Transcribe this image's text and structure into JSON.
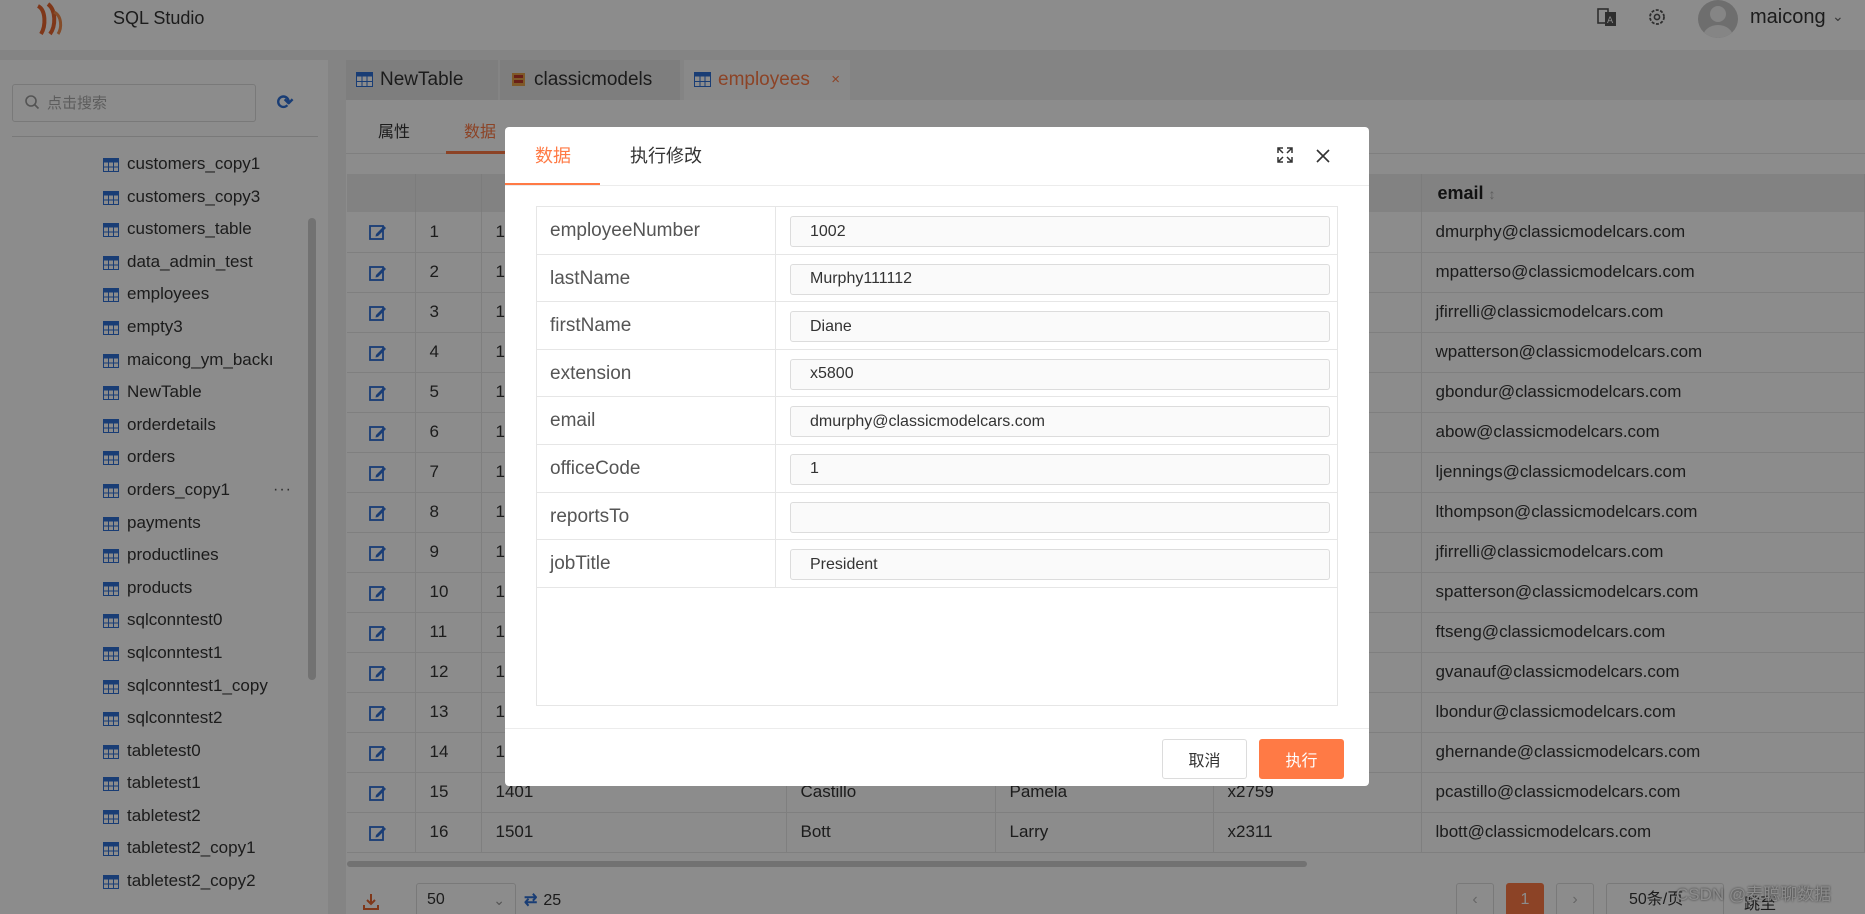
{
  "header": {
    "app_title": "SQL Studio",
    "username": "maicong"
  },
  "sidebar": {
    "search_placeholder": "点击搜索",
    "items": [
      {
        "label": "customers_copy1"
      },
      {
        "label": "customers_copy3"
      },
      {
        "label": "customers_table"
      },
      {
        "label": "data_admin_test"
      },
      {
        "label": "employees"
      },
      {
        "label": "empty3"
      },
      {
        "label": "maicong_ym_backı"
      },
      {
        "label": "NewTable"
      },
      {
        "label": "orderdetails"
      },
      {
        "label": "orders"
      },
      {
        "label": "orders_copy1",
        "more": "···"
      },
      {
        "label": "payments"
      },
      {
        "label": "productlines"
      },
      {
        "label": "products"
      },
      {
        "label": "sqlconntest0"
      },
      {
        "label": "sqlconntest1"
      },
      {
        "label": "sqlconntest1_copy"
      },
      {
        "label": "sqlconntest2"
      },
      {
        "label": "tabletest0"
      },
      {
        "label": "tabletest1"
      },
      {
        "label": "tabletest2"
      },
      {
        "label": "tabletest2_copy1"
      },
      {
        "label": "tabletest2_copy2"
      }
    ]
  },
  "tabs": [
    {
      "label": "NewTable"
    },
    {
      "label": "classicmodels"
    },
    {
      "label": "employees",
      "close": "×"
    }
  ],
  "subtabs": {
    "properties": "属性",
    "data": "数据"
  },
  "grid": {
    "email_header": "email",
    "sort_indicator": "↕",
    "rows": [
      {
        "n": "1",
        "num": "1",
        "last": "",
        "first": "",
        "ext": "",
        "email": "dmurphy@classicmodelcars.com"
      },
      {
        "n": "2",
        "num": "1",
        "last": "",
        "first": "",
        "ext": "",
        "email": "mpatterso@classicmodelcars.com"
      },
      {
        "n": "3",
        "num": "1",
        "last": "",
        "first": "",
        "ext": "",
        "email": "jfirrelli@classicmodelcars.com"
      },
      {
        "n": "4",
        "num": "1",
        "last": "",
        "first": "",
        "ext": "",
        "email": "wpatterson@classicmodelcars.com"
      },
      {
        "n": "5",
        "num": "1",
        "last": "",
        "first": "",
        "ext": "",
        "email": "gbondur@classicmodelcars.com"
      },
      {
        "n": "6",
        "num": "1",
        "last": "",
        "first": "",
        "ext": "",
        "email": "abow@classicmodelcars.com"
      },
      {
        "n": "7",
        "num": "1",
        "last": "",
        "first": "",
        "ext": "",
        "email": "ljennings@classicmodelcars.com"
      },
      {
        "n": "8",
        "num": "1",
        "last": "",
        "first": "",
        "ext": "",
        "email": "lthompson@classicmodelcars.com"
      },
      {
        "n": "9",
        "num": "1",
        "last": "",
        "first": "",
        "ext": "",
        "email": "jfirrelli@classicmodelcars.com"
      },
      {
        "n": "10",
        "num": "1",
        "last": "",
        "first": "",
        "ext": "",
        "email": "spatterson@classicmodelcars.com"
      },
      {
        "n": "11",
        "num": "1",
        "last": "",
        "first": "",
        "ext": "",
        "email": "ftseng@classicmodelcars.com"
      },
      {
        "n": "12",
        "num": "1",
        "last": "",
        "first": "",
        "ext": "",
        "email": "gvanauf@classicmodelcars.com"
      },
      {
        "n": "13",
        "num": "1",
        "last": "",
        "first": "",
        "ext": "",
        "email": "lbondur@classicmodelcars.com"
      },
      {
        "n": "14",
        "num": "1",
        "last": "",
        "first": "",
        "ext": "",
        "email": "ghernande@classicmodelcars.com"
      },
      {
        "n": "15",
        "num": "1401",
        "last": "Castillo",
        "first": "Pamela",
        "ext": "x2759",
        "email": "pcastillo@classicmodelcars.com"
      },
      {
        "n": "16",
        "num": "1501",
        "last": "Bott",
        "first": "Larry",
        "ext": "x2311",
        "email": "lbott@classicmodelcars.com"
      }
    ]
  },
  "footer": {
    "page_size": "50",
    "count": "25",
    "current_page": "1",
    "per_page": "50条/页",
    "jump_label": "跳至",
    "watermark": "CSDN @麦聪聊数据"
  },
  "modal": {
    "tab_data": "数据",
    "tab_exec": "执行修改",
    "fields": [
      {
        "label": "employeeNumber",
        "value": "1002"
      },
      {
        "label": "lastName",
        "value": "Murphy111112"
      },
      {
        "label": "firstName",
        "value": "Diane"
      },
      {
        "label": "extension",
        "value": "x5800"
      },
      {
        "label": "email",
        "value": "dmurphy@classicmodelcars.com"
      },
      {
        "label": "officeCode",
        "value": "1"
      },
      {
        "label": "reportsTo",
        "value": ""
      },
      {
        "label": "jobTitle",
        "value": "President"
      }
    ],
    "cancel": "取消",
    "execute": "执行"
  },
  "colors": {
    "accent": "#ff7a45",
    "link_blue": "#2f6fd6"
  }
}
